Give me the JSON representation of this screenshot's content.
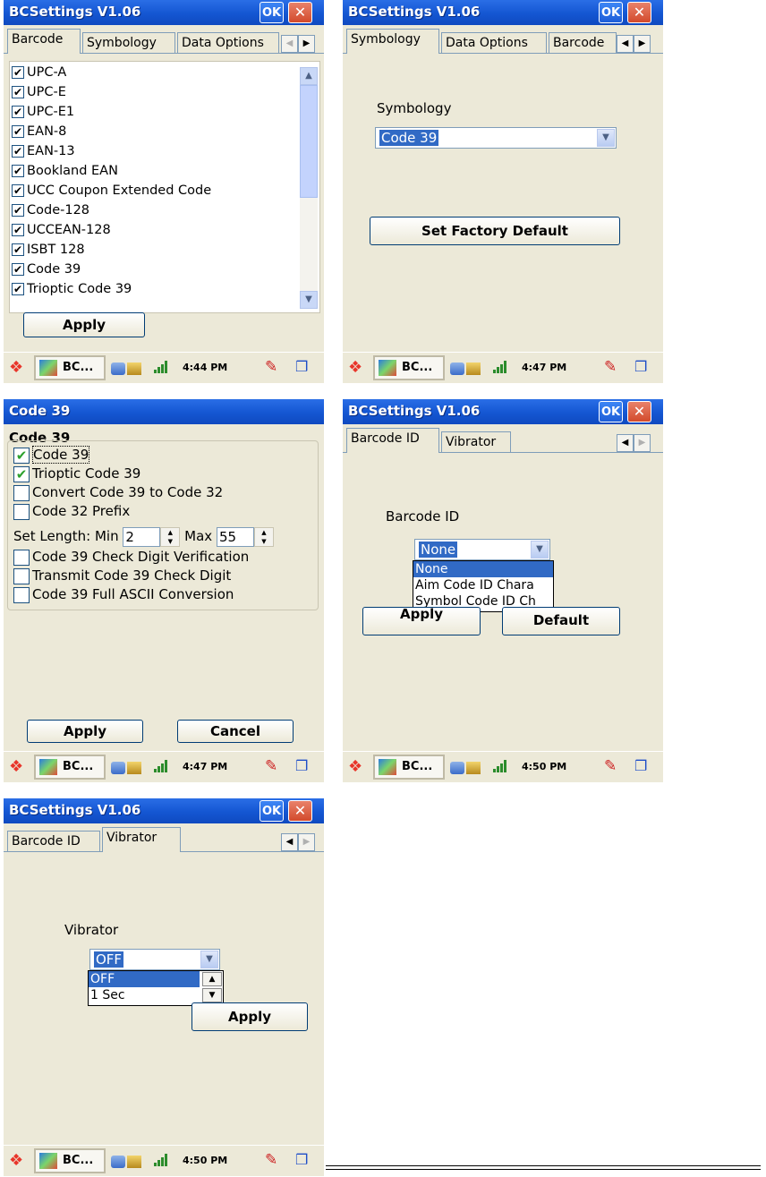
{
  "s1": {
    "title": "BCSettings V1.06",
    "ok": "OK",
    "tabs": [
      "Barcode",
      "Symbology",
      "Data Options"
    ],
    "items": [
      "UPC-A",
      "UPC-E",
      "UPC-E1",
      "EAN-8",
      "EAN-13",
      "Bookland EAN",
      "UCC Coupon Extended Code",
      "Code-128",
      "UCCEAN-128",
      "ISBT 128",
      "Code 39",
      "Trioptic Code 39"
    ],
    "apply": "Apply",
    "taskbar_app": "BC...",
    "time": "4:44 PM"
  },
  "s2": {
    "title": "BCSettings V1.06",
    "ok": "OK",
    "tabs": [
      "Symbology",
      "Data Options",
      "Barcode"
    ],
    "label": "Symbology",
    "selected": "Code 39",
    "factory": "Set Factory Default",
    "taskbar_app": "BC...",
    "time": "4:47 PM"
  },
  "s3": {
    "title": "Code 39",
    "group": "Code 39",
    "checks": [
      {
        "label": "Code 39",
        "checked": true
      },
      {
        "label": "Trioptic Code 39",
        "checked": true
      },
      {
        "label": "Convert Code 39 to Code 32",
        "checked": false
      },
      {
        "label": "Code 32 Prefix",
        "checked": false
      }
    ],
    "length_label": "Set Length: Min",
    "min": "2",
    "max_label": "Max",
    "max": "55",
    "checks2": [
      {
        "label": "Code 39 Check Digit Verification",
        "checked": false
      },
      {
        "label": "Transmit Code 39 Check Digit",
        "checked": false
      },
      {
        "label": "Code 39 Full ASCII Conversion",
        "checked": false
      }
    ],
    "apply": "Apply",
    "cancel": "Cancel",
    "taskbar_app": "BC...",
    "time": "4:47 PM"
  },
  "s4": {
    "title": "BCSettings V1.06",
    "ok": "OK",
    "tabs": [
      "Barcode ID",
      "Vibrator"
    ],
    "label": "Barcode ID",
    "selected": "None",
    "options": [
      "None",
      "Aim Code ID Chara",
      "Symbol Code ID Ch"
    ],
    "apply": "Apply",
    "default": "Default",
    "taskbar_app": "BC...",
    "time": "4:50 PM"
  },
  "s5": {
    "title": "BCSettings V1.06",
    "ok": "OK",
    "tabs": [
      "Barcode ID",
      "Vibrator"
    ],
    "label": "Vibrator",
    "selected": "OFF",
    "options": [
      "OFF",
      "1 Sec"
    ],
    "apply": "Apply",
    "taskbar_app": "BC...",
    "time": "4:50 PM"
  }
}
